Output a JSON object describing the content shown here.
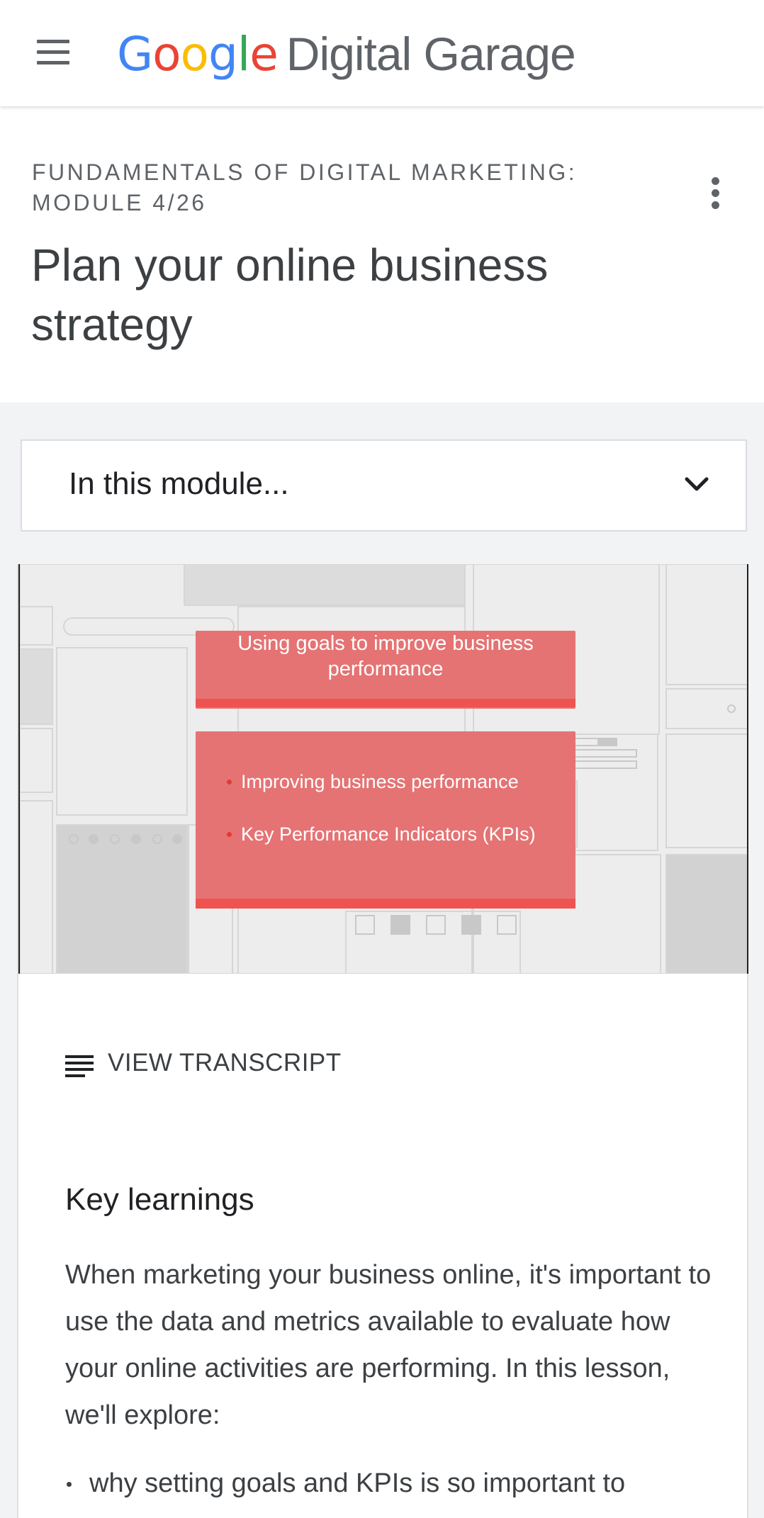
{
  "app": {
    "logo_google": "Google",
    "logo_rest": "Digital Garage",
    "brand_colors": [
      "#4285F4",
      "#EA4335",
      "#FBBC05",
      "#4285F4",
      "#34A853",
      "#EA4335"
    ]
  },
  "header": {
    "eyebrow": "FUNDAMENTALS OF DIGITAL MARKETING: MODULE 4/26",
    "title": "Plan your online business strategy",
    "more_icon": "more-vert-icon"
  },
  "module_dropdown": {
    "label": "In this module...",
    "icon": "chevron-down-icon"
  },
  "video": {
    "slide_title": "Using goals to improve business performance",
    "bullets": [
      "Improving business performance",
      "Key Performance Indicators (KPIs)"
    ],
    "accent": "#e57373"
  },
  "transcript": {
    "label": "VIEW TRANSCRIPT",
    "icon": "transcript-icon"
  },
  "key_learnings": {
    "heading": "Key learnings",
    "body": "When marketing your business online, it's important to use the data and metrics available to evaluate how your online activities are performing. In this lesson, we'll explore:",
    "items": [
      "why setting goals and KPIs is so important to"
    ]
  }
}
